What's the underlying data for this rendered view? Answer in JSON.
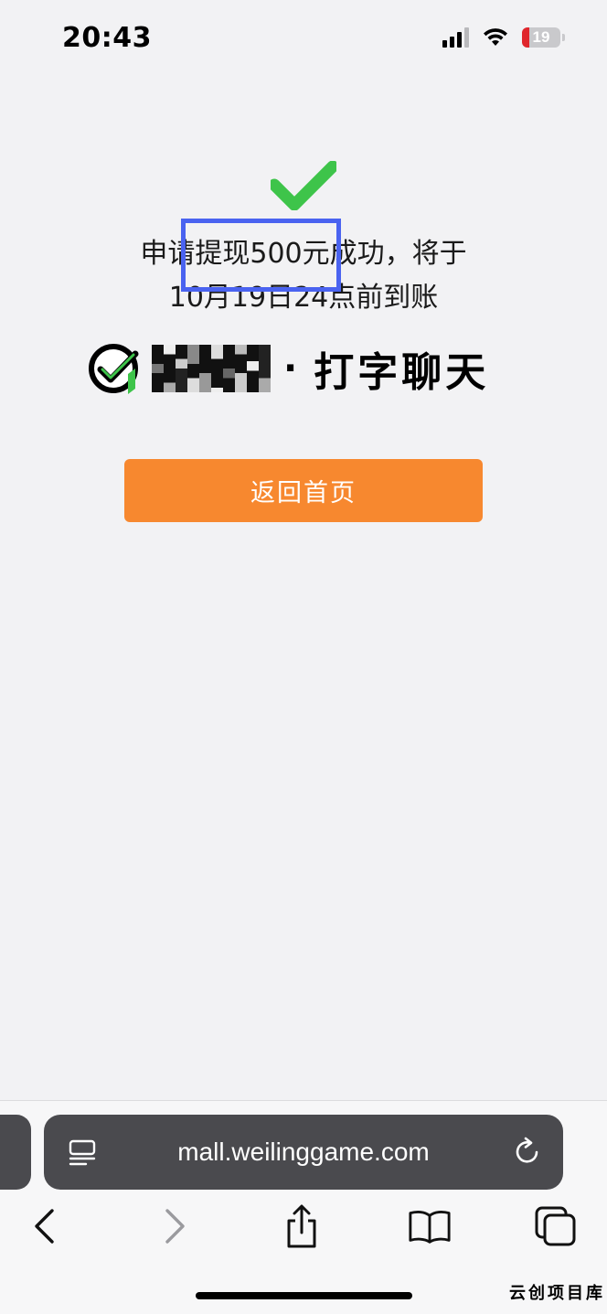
{
  "status_bar": {
    "time": "20:43",
    "battery_level": "19",
    "battery_fraction": 0.19,
    "battery_color": "#e0262c",
    "icons": [
      "signal-icon",
      "wifi-icon",
      "battery-icon"
    ]
  },
  "result": {
    "icon": "checkmark-icon",
    "icon_color": "#3ec44a",
    "message_line1": "申请提现500元成功，将于",
    "message_line2": "10月19日24点前到账",
    "highlight_color": "#4a63f0"
  },
  "brand": {
    "icon": "check-circle-logo-icon",
    "separator": "·",
    "name": "打字聊天"
  },
  "actions": {
    "home_button_label": "返回首页",
    "home_button_color": "#f7882f"
  },
  "browser": {
    "url": "mall.weilinggame.com",
    "icons": [
      "reader-icon",
      "reload-icon",
      "back-icon",
      "forward-icon",
      "share-icon",
      "bookmarks-icon",
      "tabs-icon"
    ]
  },
  "watermark": "云创项目库"
}
